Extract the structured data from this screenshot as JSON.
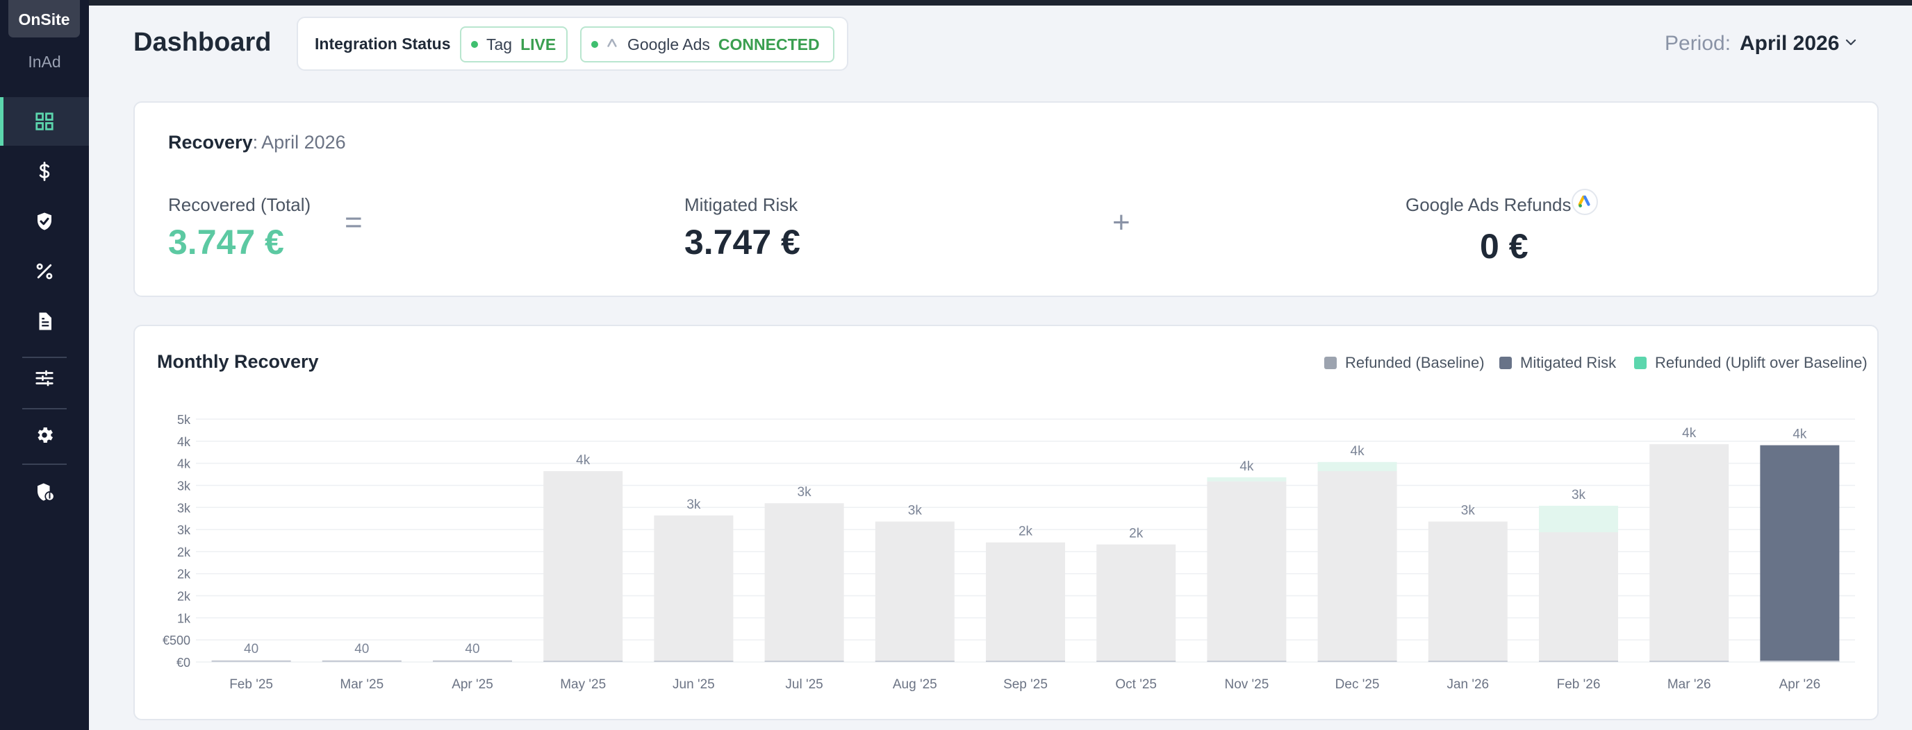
{
  "sidebar": {
    "tabs": [
      {
        "label": "OnSite"
      },
      {
        "label": "InAd"
      }
    ],
    "nav": [
      {
        "icon": "dashboard-grid-icon"
      },
      {
        "icon": "dollar-icon"
      },
      {
        "icon": "shield-check-icon"
      },
      {
        "icon": "percent-icon"
      },
      {
        "icon": "document-icon"
      },
      {
        "icon": "sliders-icon"
      },
      {
        "icon": "gear-icon"
      },
      {
        "icon": "shield-info-icon"
      }
    ]
  },
  "header": {
    "title": "Dashboard",
    "integration": {
      "label": "Integration Status",
      "items": [
        {
          "name": "Tag",
          "status": "LIVE"
        },
        {
          "name": "Google Ads",
          "status": "CONNECTED"
        }
      ]
    },
    "period": {
      "label": "Period:",
      "value": "April 2026"
    }
  },
  "recovery": {
    "title": "Recovery",
    "colon": ":",
    "month": "April 2026",
    "recovered_label": "Recovered (Total)",
    "recovered_value": "3.747 €",
    "equals": "=",
    "mitigated_label": "Mitigated Risk",
    "mitigated_value": "3.747 €",
    "plus": "+",
    "refunds_label": "Google Ads Refunds",
    "refunds_value": "0 €"
  },
  "colors": {
    "accent_green": "#5cc9a2",
    "baseline": "#ebebec",
    "mitigated": "#687388",
    "uplift": "#e2f6ee",
    "legend_baseline": "#9ca3af",
    "legend_mitigated": "#687388",
    "legend_uplift": "#5cd6ad"
  },
  "chart_data": {
    "type": "bar",
    "title": "Monthly Recovery",
    "legend_position": "top-right",
    "categories": [
      "Feb '25",
      "Mar '25",
      "Apr '25",
      "May '25",
      "Jun '25",
      "Jul '25",
      "Aug '25",
      "Sep '25",
      "Oct '25",
      "Nov '25",
      "Dec '25",
      "Jan '26",
      "Feb '26",
      "Mar '26",
      "Apr '26"
    ],
    "y_ticks": [
      "€0",
      "€500",
      "1k",
      "2k",
      "2k",
      "2k",
      "3k",
      "3k",
      "3k",
      "4k",
      "4k",
      "5k"
    ],
    "ylim": [
      0,
      4500
    ],
    "grid": true,
    "series": [
      {
        "name": "Refunded (Baseline)",
        "values": [
          40,
          40,
          40,
          3750,
          2880,
          3120,
          2760,
          2350,
          2310,
          3550,
          3750,
          2760,
          2550,
          4280,
          0
        ]
      },
      {
        "name": "Mitigated Risk",
        "values": [
          0,
          0,
          0,
          0,
          0,
          0,
          0,
          0,
          0,
          0,
          0,
          0,
          0,
          0,
          4260
        ]
      },
      {
        "name": "Refunded (Uplift over Baseline)",
        "values": [
          0,
          0,
          0,
          0,
          0,
          0,
          0,
          0,
          0,
          80,
          180,
          0,
          520,
          0,
          0
        ]
      }
    ],
    "data_labels": [
      "40",
      "40",
      "40",
      "4k",
      "3k",
      "3k",
      "3k",
      "2k",
      "2k",
      "4k",
      "4k",
      "3k",
      "3k",
      "4k",
      "4k"
    ]
  }
}
